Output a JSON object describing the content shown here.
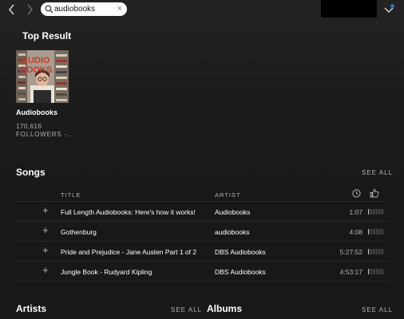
{
  "search": {
    "value": "audiobooks"
  },
  "top_result": {
    "heading": "Top Result",
    "cover_text": "AUDIO BOOKS",
    "name": "Audiobooks",
    "followers_count": "170,616",
    "followers_label": "FOLLOWERS -..."
  },
  "songs": {
    "heading": "Songs",
    "see_all": "SEE ALL",
    "columns": {
      "title": "TITLE",
      "artist": "ARTIST"
    },
    "rows": [
      {
        "title": "Full Length Audiobooks: Here's how it works!",
        "artist": "Audiobooks",
        "duration": "1:07",
        "popularity": 0.1
      },
      {
        "title": "Gothenburg",
        "artist": "audiobooks",
        "duration": "4:08",
        "popularity": 0.1
      },
      {
        "title": "Pride and Prejudice - Jane Austen Part 1 of 2",
        "artist": "DBS Audiobooks",
        "duration": "5:27:52",
        "popularity": 0.1
      },
      {
        "title": "Jungle Book - Rudyard Kipling",
        "artist": "DBS Audiobooks",
        "duration": "4:53:17",
        "popularity": 0.1
      }
    ]
  },
  "artists": {
    "heading": "Artists",
    "see_all": "SEE ALL"
  },
  "albums": {
    "heading": "Albums",
    "see_all": "SEE ALL"
  },
  "colors": {
    "background": "#181818",
    "accent": "#1db954",
    "text_muted": "#b3b3b3"
  },
  "icons": [
    "chevron-left-icon",
    "chevron-right-icon",
    "search-icon",
    "clear-icon",
    "user-menu-chevron-icon",
    "clock-icon",
    "thumbs-up-icon",
    "add-icon"
  ]
}
